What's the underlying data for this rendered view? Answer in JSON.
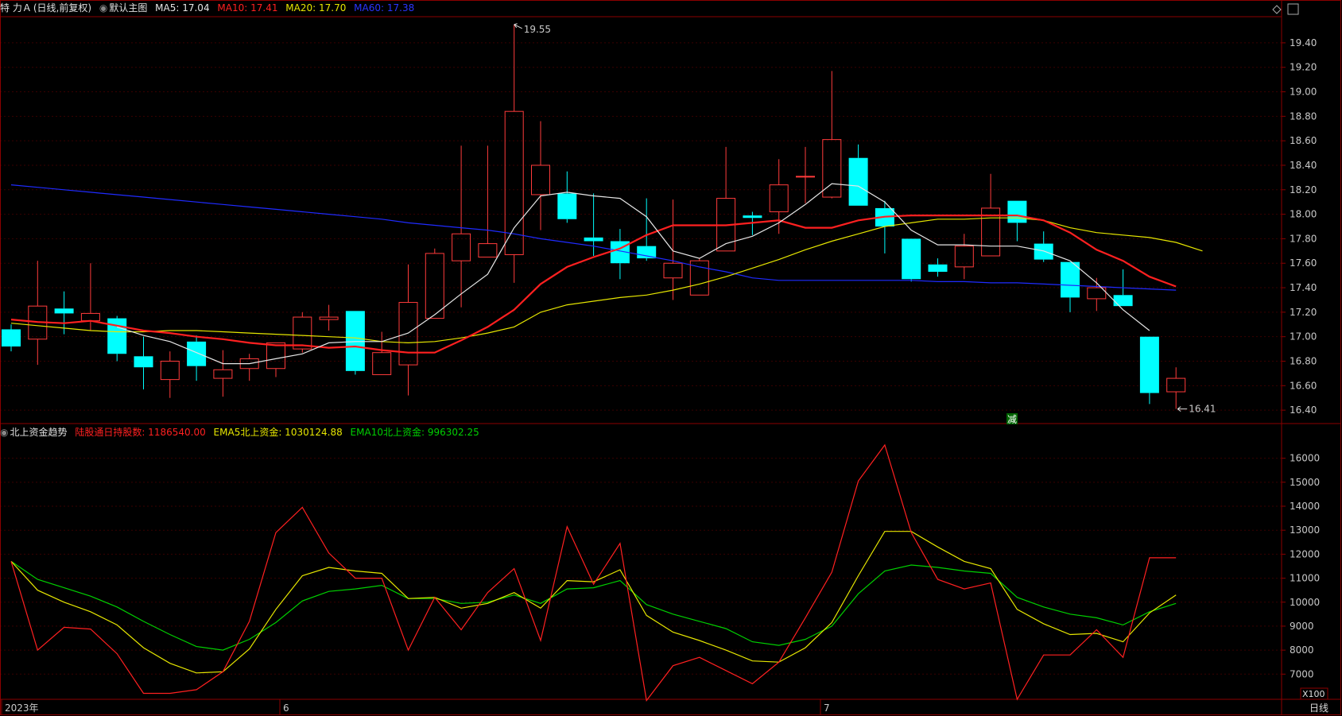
{
  "colors": {
    "bg": "#000000",
    "grid": "#3a0000",
    "frame": "#8b0000",
    "up": "#ff3b3b",
    "down": "#00ffff",
    "ma5": "#e6e6e6",
    "ma10": "#ff2020",
    "ma20": "#e6e600",
    "ma60": "#1f2bff",
    "lgt": "#ff2020",
    "ema5": "#e6e600",
    "ema10": "#00d000"
  },
  "header_main": {
    "stock": "特 力Ａ",
    "period": "(日线,前复权)",
    "template": "默认主图",
    "ma5_label": "MA5: 17.04",
    "ma10_label": "MA10: 17.41",
    "ma20_label": "MA20: 17.70",
    "ma60_label": "MA60: 17.38"
  },
  "header_sub": {
    "title": "北上资金趋势",
    "lgt_label": "陆股通日持股数: 1186540.00",
    "ema5_label": "EMA5北上资金: 1030124.88",
    "ema10_label": "EMA10北上资金: 996302.25"
  },
  "markers": {
    "high": "19.55",
    "low": "16.41",
    "reduce_tag": "减",
    "x_unit": "X100",
    "period_btn": "日线"
  },
  "x_labels": [
    "2023年",
    "6",
    "7"
  ],
  "chart_data": [
    {
      "type": "candlestick",
      "y_ticks": [
        "19.40",
        "19.20",
        "19.00",
        "18.80",
        "18.60",
        "18.40",
        "18.20",
        "18.00",
        "17.80",
        "17.60",
        "17.40",
        "17.20",
        "17.00",
        "16.80",
        "16.60",
        "16.40"
      ],
      "ylim": [
        16.31,
        19.62
      ],
      "candles": [
        {
          "o": 17.06,
          "h": 17.1,
          "l": 16.88,
          "c": 16.92
        },
        {
          "o": 16.98,
          "h": 17.62,
          "l": 16.77,
          "c": 17.25
        },
        {
          "o": 17.23,
          "h": 17.37,
          "l": 17.02,
          "c": 17.19
        },
        {
          "o": 17.13,
          "h": 17.6,
          "l": 17.05,
          "c": 17.19
        },
        {
          "o": 17.15,
          "h": 17.17,
          "l": 16.8,
          "c": 16.86
        },
        {
          "o": 16.84,
          "h": 17.0,
          "l": 16.57,
          "c": 16.75
        },
        {
          "o": 16.65,
          "h": 16.88,
          "l": 16.5,
          "c": 16.8
        },
        {
          "o": 16.96,
          "h": 17.01,
          "l": 16.64,
          "c": 16.76
        },
        {
          "o": 16.66,
          "h": 16.89,
          "l": 16.51,
          "c": 16.73
        },
        {
          "o": 16.74,
          "h": 16.86,
          "l": 16.64,
          "c": 16.82
        },
        {
          "o": 16.74,
          "h": 16.95,
          "l": 16.67,
          "c": 16.95
        },
        {
          "o": 16.9,
          "h": 17.2,
          "l": 16.87,
          "c": 17.16
        },
        {
          "o": 17.14,
          "h": 17.26,
          "l": 17.05,
          "c": 17.16
        },
        {
          "o": 17.21,
          "h": 17.21,
          "l": 16.69,
          "c": 16.72
        },
        {
          "o": 16.69,
          "h": 17.04,
          "l": 16.69,
          "c": 16.87
        },
        {
          "o": 16.77,
          "h": 17.59,
          "l": 16.52,
          "c": 17.28
        },
        {
          "o": 17.15,
          "h": 17.72,
          "l": 17.15,
          "c": 17.68
        },
        {
          "o": 17.62,
          "h": 18.56,
          "l": 17.24,
          "c": 17.84
        },
        {
          "o": 17.65,
          "h": 18.56,
          "l": 17.65,
          "c": 17.76
        },
        {
          "o": 17.67,
          "h": 19.55,
          "l": 17.44,
          "c": 18.84
        },
        {
          "o": 18.16,
          "h": 18.76,
          "l": 17.87,
          "c": 18.4
        },
        {
          "o": 18.17,
          "h": 18.35,
          "l": 17.93,
          "c": 17.96
        },
        {
          "o": 17.81,
          "h": 18.17,
          "l": 17.66,
          "c": 17.78
        },
        {
          "o": 17.78,
          "h": 17.88,
          "l": 17.47,
          "c": 17.6
        },
        {
          "o": 17.74,
          "h": 18.13,
          "l": 17.62,
          "c": 17.64
        },
        {
          "o": 17.48,
          "h": 18.12,
          "l": 17.3,
          "c": 17.6
        },
        {
          "o": 17.34,
          "h": 17.64,
          "l": 17.34,
          "c": 17.62
        },
        {
          "o": 17.7,
          "h": 18.55,
          "l": 17.7,
          "c": 18.13
        },
        {
          "o": 17.99,
          "h": 18.02,
          "l": 17.83,
          "c": 17.97
        },
        {
          "o": 18.02,
          "h": 18.45,
          "l": 17.84,
          "c": 18.24
        },
        {
          "o": 18.31,
          "h": 18.55,
          "l": 18.09,
          "c": 18.31
        },
        {
          "o": 18.14,
          "h": 19.17,
          "l": 18.13,
          "c": 18.61
        },
        {
          "o": 18.46,
          "h": 18.57,
          "l": 18.07,
          "c": 18.07
        },
        {
          "o": 18.05,
          "h": 18.11,
          "l": 17.68,
          "c": 17.9
        },
        {
          "o": 17.8,
          "h": 17.8,
          "l": 17.45,
          "c": 17.47
        },
        {
          "o": 17.59,
          "h": 17.64,
          "l": 17.49,
          "c": 17.53
        },
        {
          "o": 17.57,
          "h": 17.84,
          "l": 17.47,
          "c": 17.74
        },
        {
          "o": 17.66,
          "h": 18.33,
          "l": 17.66,
          "c": 18.05
        },
        {
          "o": 18.11,
          "h": 18.11,
          "l": 17.78,
          "c": 17.93
        },
        {
          "o": 17.76,
          "h": 17.86,
          "l": 17.61,
          "c": 17.63
        },
        {
          "o": 17.61,
          "h": 17.61,
          "l": 17.2,
          "c": 17.32
        },
        {
          "o": 17.31,
          "h": 17.48,
          "l": 17.21,
          "c": 17.4
        },
        {
          "o": 17.34,
          "h": 17.55,
          "l": 17.25,
          "c": 17.25
        },
        {
          "o": 17.0,
          "h": 17.0,
          "l": 16.45,
          "c": 16.54
        },
        {
          "o": 16.55,
          "h": 16.75,
          "l": 16.41,
          "c": 16.66
        }
      ],
      "ma5": [
        null,
        null,
        null,
        null,
        17.08,
        17.01,
        16.96,
        16.87,
        16.78,
        16.78,
        16.82,
        16.86,
        16.95,
        16.96,
        16.96,
        17.03,
        17.18,
        17.35,
        17.51,
        17.89,
        18.15,
        18.18,
        18.15,
        18.13,
        17.98,
        17.7,
        17.64,
        17.76,
        17.82,
        17.93,
        18.08,
        18.25,
        18.23,
        18.1,
        17.87,
        17.75,
        17.75,
        17.74,
        17.74,
        17.7,
        17.62,
        17.44,
        17.22,
        17.05
      ],
      "ma10": [
        17.14,
        17.12,
        17.11,
        17.13,
        17.09,
        17.05,
        17.03,
        17.0,
        16.98,
        16.95,
        16.93,
        16.93,
        16.91,
        16.92,
        16.89,
        16.87,
        16.87,
        16.97,
        17.08,
        17.22,
        17.43,
        17.57,
        17.65,
        17.72,
        17.83,
        17.91,
        17.91,
        17.91,
        17.93,
        17.95,
        17.89,
        17.89,
        17.95,
        17.98,
        17.99,
        17.99,
        17.99,
        17.99,
        17.99,
        17.95,
        17.85,
        17.71,
        17.62,
        17.49,
        17.41
      ],
      "ma20": [
        17.11,
        17.09,
        17.07,
        17.05,
        17.04,
        17.04,
        17.05,
        17.05,
        17.04,
        17.03,
        17.02,
        17.01,
        17.0,
        16.99,
        16.96,
        16.95,
        16.96,
        16.99,
        17.03,
        17.08,
        17.2,
        17.26,
        17.29,
        17.32,
        17.34,
        17.38,
        17.43,
        17.49,
        17.56,
        17.63,
        17.71,
        17.78,
        17.84,
        17.9,
        17.93,
        17.96,
        17.96,
        17.97,
        17.97,
        17.95,
        17.89,
        17.85,
        17.83,
        17.81,
        17.77,
        17.7
      ],
      "ma60": [
        18.24,
        18.22,
        18.2,
        18.18,
        18.16,
        18.14,
        18.12,
        18.1,
        18.08,
        18.06,
        18.04,
        18.02,
        18.0,
        17.98,
        17.96,
        17.93,
        17.91,
        17.89,
        17.87,
        17.84,
        17.8,
        17.77,
        17.74,
        17.7,
        17.66,
        17.62,
        17.57,
        17.53,
        17.48,
        17.46,
        17.46,
        17.46,
        17.46,
        17.46,
        17.46,
        17.45,
        17.45,
        17.44,
        17.44,
        17.43,
        17.42,
        17.41,
        17.4,
        17.39,
        17.38
      ]
    },
    {
      "type": "line",
      "y_ticks": [
        "16000",
        "15000",
        "14000",
        "13000",
        "12000",
        "11000",
        "10000",
        "9000",
        "8000",
        "7000"
      ],
      "ylim": [
        5950,
        16750
      ],
      "series": [
        {
          "key": "lgt",
          "values": [
            11700,
            8000,
            8950,
            8880,
            7850,
            6200,
            6200,
            6350,
            7100,
            9200,
            12900,
            13950,
            12050,
            11000,
            11000,
            8000,
            10200,
            8850,
            10400,
            11400,
            8400,
            13150,
            10750,
            12450,
            5900,
            7350,
            7700,
            7150,
            6600,
            7500,
            9350,
            11250,
            15050,
            16550,
            12900,
            10950,
            10550,
            10800,
            5950,
            7800,
            7800,
            8850,
            7700,
            11850,
            11850
          ]
        },
        {
          "key": "ema5",
          "values": [
            11700,
            10500,
            10000,
            9600,
            9050,
            8100,
            7450,
            7050,
            7100,
            8050,
            9700,
            11100,
            11450,
            11300,
            11200,
            10150,
            10200,
            9750,
            9950,
            10400,
            9750,
            10900,
            10850,
            11350,
            9450,
            8750,
            8400,
            8000,
            7550,
            7500,
            8100,
            9150,
            11100,
            12950,
            12950,
            12300,
            11700,
            11400,
            9700,
            9100,
            8650,
            8700,
            8350,
            9550,
            10300
          ]
        },
        {
          "key": "ema10",
          "values": [
            11700,
            10950,
            10600,
            10250,
            9800,
            9200,
            8650,
            8150,
            8000,
            8450,
            9150,
            10050,
            10450,
            10550,
            10700,
            10150,
            10150,
            9950,
            10000,
            10300,
            9950,
            10550,
            10600,
            10900,
            9900,
            9500,
            9200,
            8900,
            8350,
            8200,
            8450,
            9000,
            10350,
            11300,
            11550,
            11450,
            11300,
            11200,
            10200,
            9800,
            9500,
            9350,
            9050,
            9600,
            9950
          ]
        }
      ]
    }
  ]
}
